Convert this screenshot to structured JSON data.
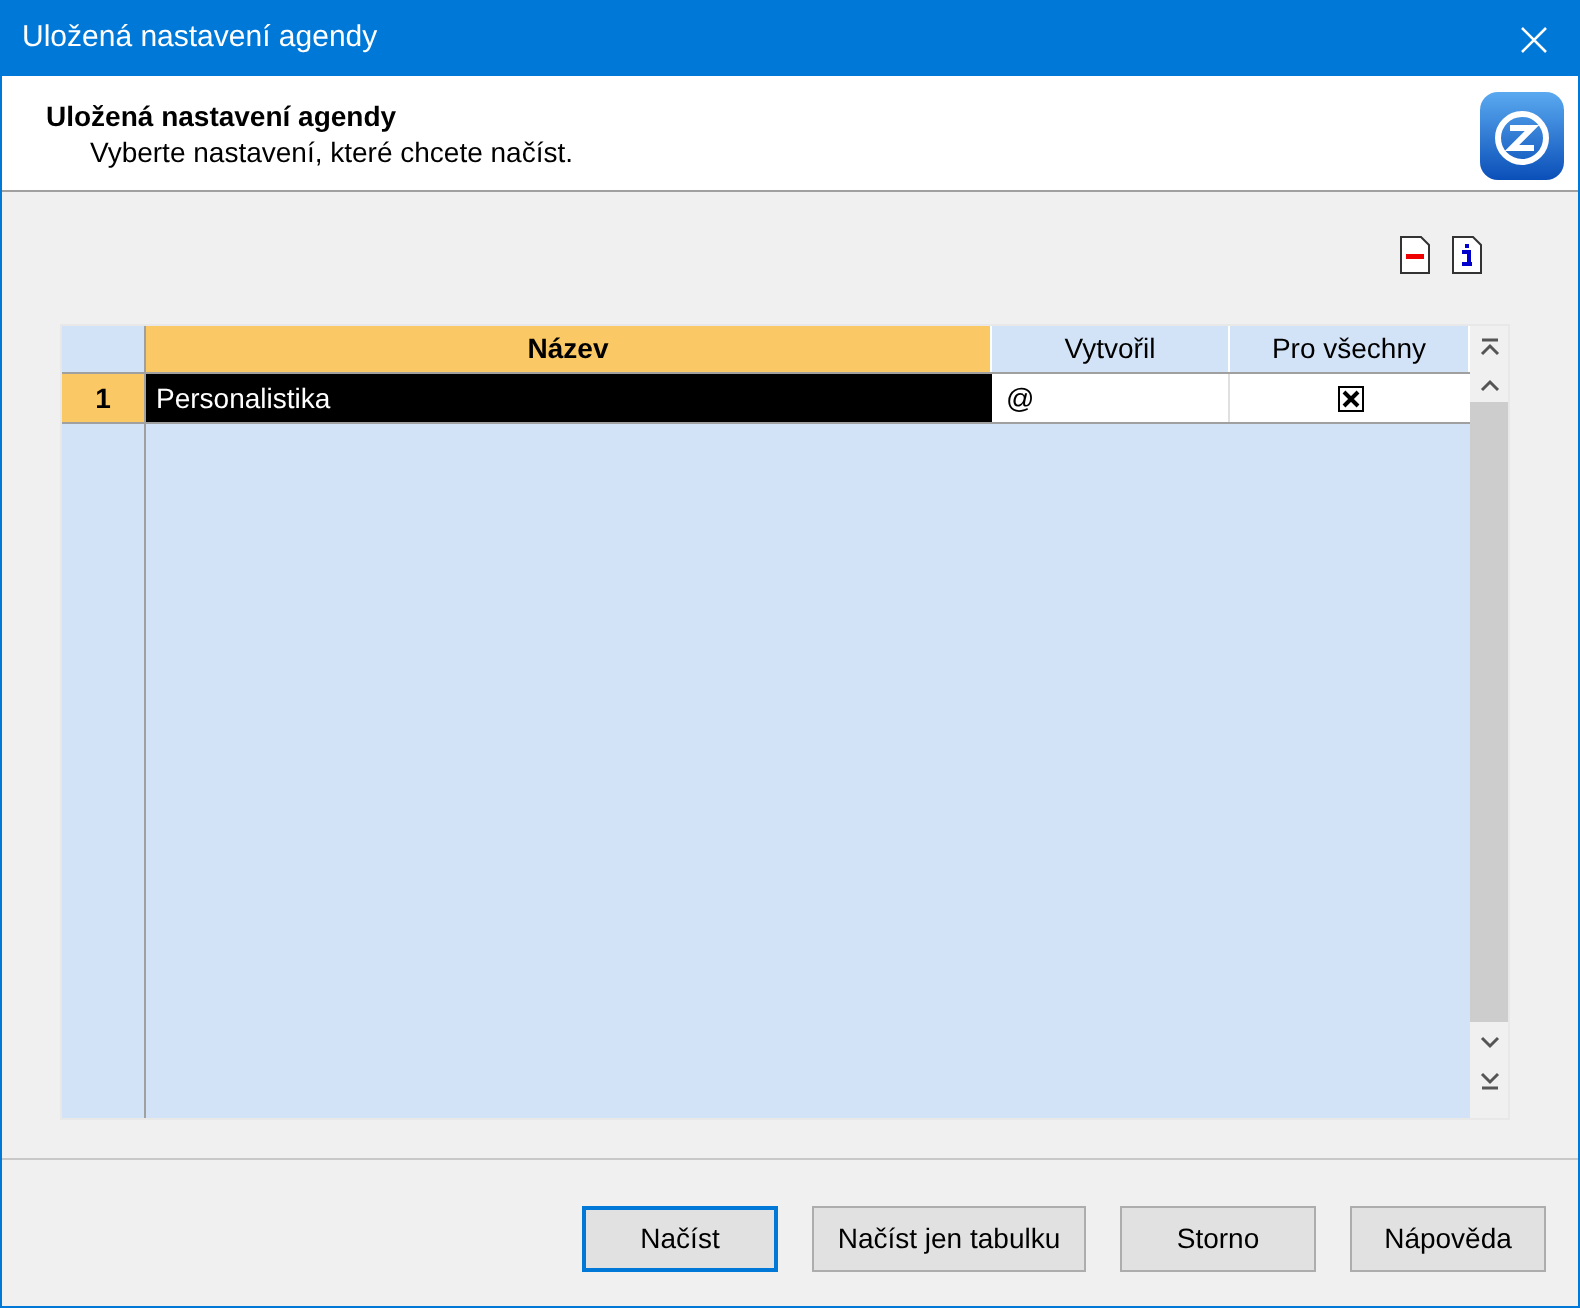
{
  "window": {
    "title": "Uložená nastavení agendy"
  },
  "header": {
    "title": "Uložená nastavení agendy",
    "subtitle": "Vyberte nastavení, které chcete načíst."
  },
  "table": {
    "columns": [
      {
        "label": "Název",
        "selected": true
      },
      {
        "label": "Vytvořil",
        "selected": false
      },
      {
        "label": "Pro všechny",
        "selected": false
      }
    ],
    "rows": [
      {
        "number": "1",
        "selected": true,
        "name": "Personalistika",
        "author": "@",
        "for_all": true
      }
    ]
  },
  "buttons": [
    {
      "label": "Načíst",
      "default": true
    },
    {
      "label": "Načíst jen tabulku",
      "default": false
    },
    {
      "label": "Storno",
      "default": false
    },
    {
      "label": "Nápověda",
      "default": false
    }
  ]
}
